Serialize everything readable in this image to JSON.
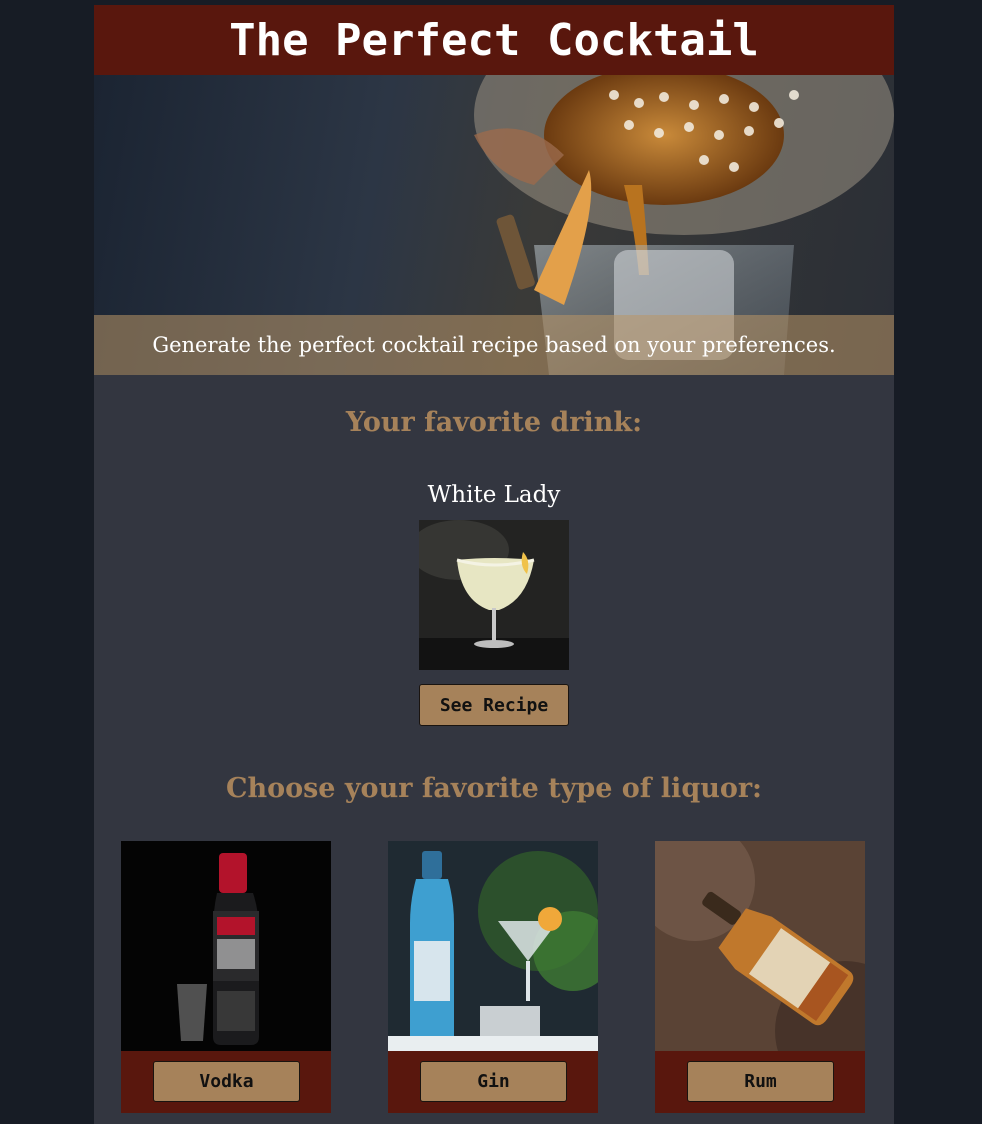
{
  "header": {
    "title": "The Perfect Cocktail"
  },
  "hero": {
    "caption": "Generate the perfect cocktail recipe based on your preferences."
  },
  "favorite": {
    "heading": "Your favorite drink:",
    "drink_name": "White Lady",
    "button_label": "See Recipe"
  },
  "liquor": {
    "heading": "Choose your favorite type of liquor:",
    "options": [
      {
        "label": "Vodka"
      },
      {
        "label": "Gin"
      },
      {
        "label": "Rum"
      }
    ]
  },
  "colors": {
    "page_background": "#171c25",
    "content_background": "#333640",
    "header_red": "#59170d",
    "accent_tan": "#a6825a"
  }
}
